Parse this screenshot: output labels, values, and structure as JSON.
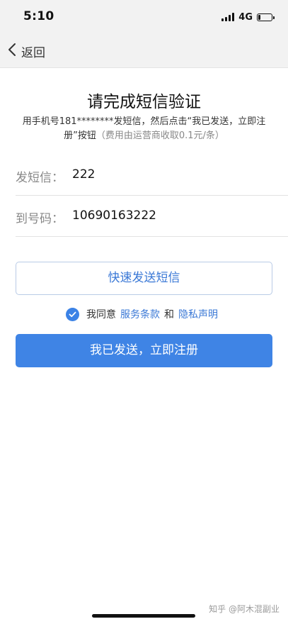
{
  "status_bar": {
    "time": "5:10",
    "network": "4G",
    "battery_level": 0.15
  },
  "nav": {
    "back_label": "返回"
  },
  "page": {
    "title": "请完成短信验证",
    "instruction": "用手机号181********发短信，然后点击“我已发送，立即注册”按钮",
    "fee_note": "（费用由运营商收取0.1元/条）"
  },
  "fields": [
    {
      "label": "发短信：",
      "value": "222"
    },
    {
      "label": "到号码：",
      "value": "10690163222"
    }
  ],
  "buttons": {
    "quick_send": "快速发送短信",
    "register": "我已发送，立即注册"
  },
  "agreement": {
    "checked": true,
    "prefix": "我同意",
    "terms_link": "服务条款",
    "conjunction": "和",
    "privacy_link": "隐私声明"
  },
  "watermark": "知乎 @阿木混副业",
  "colors": {
    "accent": "#3f84e5",
    "link": "#3a78d6",
    "background": "#ffffff",
    "bar_background": "#f2f2f2"
  }
}
